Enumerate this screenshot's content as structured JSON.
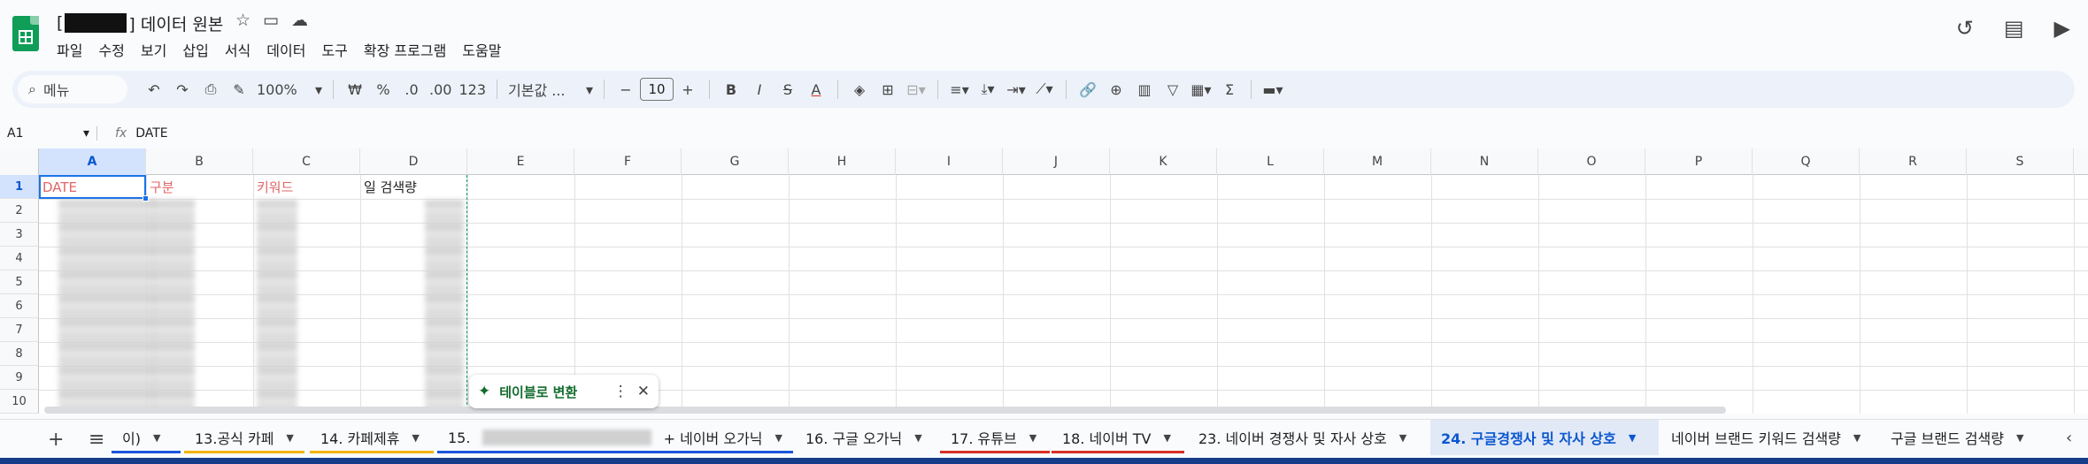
{
  "doc": {
    "title_prefix": "[",
    "title_suffix": "] 데이터 원본"
  },
  "menu": [
    "파일",
    "수정",
    "보기",
    "삽입",
    "서식",
    "데이터",
    "도구",
    "확장 프로그램",
    "도움말"
  ],
  "toolbar": {
    "search_label": "메뉴",
    "zoom": "100%",
    "currency": "₩",
    "percent": "%",
    "dec_decrease": ".0",
    "dec_increase": ".00",
    "format_123": "123",
    "font_name": "기본값 ...",
    "font_size": "10",
    "bold": "B",
    "italic": "I",
    "strike": "S",
    "text_color": "A"
  },
  "formula": {
    "cell_ref": "A1",
    "fx": "fx",
    "value": "DATE"
  },
  "grid": {
    "columns": [
      "A",
      "B",
      "C",
      "D",
      "E",
      "F",
      "G",
      "H",
      "I",
      "J",
      "K",
      "L",
      "M",
      "N",
      "O",
      "P",
      "Q",
      "R",
      "S"
    ],
    "rows": [
      "1",
      "2",
      "3",
      "4",
      "5",
      "6",
      "7",
      "8",
      "9",
      "10"
    ],
    "header_cells": [
      "DATE",
      "구분",
      "키워드",
      "일 검색량"
    ]
  },
  "chip": {
    "label": "테이블로 변환"
  },
  "tabs": [
    {
      "label": "이)",
      "color": "#1a56db"
    },
    {
      "label": "13.공식 카페",
      "color": "#f4b400"
    },
    {
      "label": "14. 카페제휴",
      "color": "#f4b400"
    },
    {
      "label": "15.",
      "suffix": "+ 네이버 오가닉",
      "color": "#1a56db"
    },
    {
      "label": "16. 구글 오가닉",
      "color": ""
    },
    {
      "label": "17. 유튜브",
      "color": "#d93025"
    },
    {
      "label": "18. 네이버 TV",
      "color": "#d93025"
    },
    {
      "label": "23. 네이버 경쟁사 및 자사 상호",
      "color": ""
    },
    {
      "label": "24. 구글경쟁사 및 자사 상호",
      "color": "",
      "active": true
    },
    {
      "label": "네이버 브랜드 키워드 검색량",
      "color": ""
    },
    {
      "label": "구글 브랜드 검색량",
      "color": ""
    }
  ]
}
